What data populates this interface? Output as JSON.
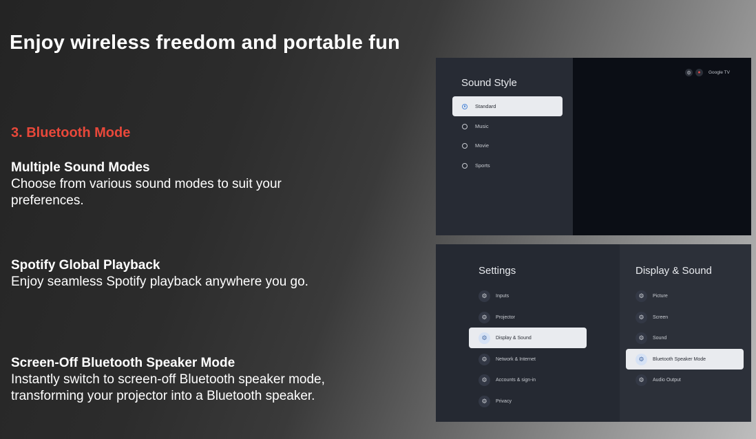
{
  "headline": "Enjoy wireless freedom and portable fun",
  "section_title": "3. Bluetooth Mode",
  "features": [
    {
      "title": "Multiple Sound Modes",
      "description": "Choose from various sound modes to suit your preferences."
    },
    {
      "title": "Spotify Global Playback",
      "description": "Enjoy seamless Spotify playback anywhere you go."
    },
    {
      "title": "Screen-Off Bluetooth Speaker Mode",
      "description": "Instantly switch to screen-off Bluetooth speaker mode, transforming your projector into a Bluetooth speaker."
    }
  ],
  "sound_style": {
    "title": "Sound Style",
    "options": [
      "Standard",
      "Music",
      "Movie",
      "Sports"
    ],
    "selected": "Standard",
    "status": {
      "icons": [
        "gear-icon",
        "notification-icon"
      ],
      "brand": "Google TV"
    }
  },
  "settings": {
    "title": "Settings",
    "items": [
      "Inputs",
      "Projector",
      "Display & Sound",
      "Network & Internet",
      "Accounts & sign-in",
      "Privacy"
    ],
    "selected": "Display & Sound"
  },
  "display_sound": {
    "title": "Display & Sound",
    "items": [
      "Picture",
      "Screen",
      "Sound",
      "Bluetooth Speaker Mode",
      "Audio Output"
    ],
    "selected": "Bluetooth Speaker Mode"
  },
  "colors": {
    "accent_red": "#e8483a",
    "selection_blue": "#4b86d8"
  }
}
